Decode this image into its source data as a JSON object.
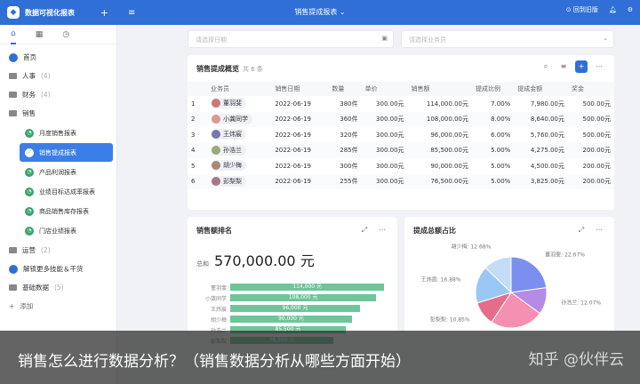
{
  "app": {
    "title": "数据可视化报表",
    "page_title": "销售提成报表",
    "return_label": "回到旧版"
  },
  "sidebar": {
    "items": [
      {
        "label": "首页",
        "count": ""
      },
      {
        "label": "人事",
        "count": "(4)"
      },
      {
        "label": "财务",
        "count": "(4)"
      },
      {
        "label": "销售",
        "count": ""
      },
      {
        "label": "运营",
        "count": "(2)"
      },
      {
        "label": "解锁更多技能＆干货",
        "count": ""
      },
      {
        "label": "基础数据",
        "count": "(5)"
      }
    ],
    "sales_subitems": [
      "月度销售报表",
      "销售提成报表",
      "产品利润报表",
      "业绩目标达成率报表",
      "商品销售库存报表",
      "门店业绩报表"
    ],
    "add_label": "添加"
  },
  "filters": {
    "date_placeholder": "请选择日期",
    "salesperson_placeholder": "请选择业务员"
  },
  "table_card": {
    "title": "销售提成概览",
    "subtitle": "共 6 条",
    "columns": [
      "业务员",
      "销售日期",
      "数量",
      "单价",
      "销售额",
      "提成比例",
      "提成金额",
      "奖金"
    ],
    "rows": [
      {
        "idx": "1",
        "name": "董羽斐",
        "date": "2022-06-19",
        "qty": "380件",
        "price": "300.00元",
        "sales": "114,000.00元",
        "rate": "7.00%",
        "commission": "7,980.00元",
        "bonus": "500.00元"
      },
      {
        "idx": "2",
        "name": "小龚同学",
        "date": "2022-06-19",
        "qty": "360件",
        "price": "300.00元",
        "sales": "108,000.00元",
        "rate": "8.00%",
        "commission": "8,640.00元",
        "bonus": "500.00元"
      },
      {
        "idx": "3",
        "name": "王炜宸",
        "date": "2022-06-19",
        "qty": "320件",
        "price": "300.00元",
        "sales": "96,000.00元",
        "rate": "6.00%",
        "commission": "5,760.00元",
        "bonus": "500.00元"
      },
      {
        "idx": "4",
        "name": "孙浩兰",
        "date": "2022-06-19",
        "qty": "285件",
        "price": "300.00元",
        "sales": "85,500.00元",
        "rate": "5.00%",
        "commission": "4,275.00元",
        "bonus": "200.00元"
      },
      {
        "idx": "5",
        "name": "胡少梅",
        "date": "2022-06-19",
        "qty": "300件",
        "price": "300.00元",
        "sales": "90,000.00元",
        "rate": "5.00%",
        "commission": "4,500.00元",
        "bonus": "200.00元"
      },
      {
        "idx": "6",
        "name": "彭梨梨",
        "date": "2022-06-19",
        "qty": "255件",
        "price": "300.00元",
        "sales": "76,500.00元",
        "rate": "5.00%",
        "commission": "3,825.00元",
        "bonus": "200.00元"
      }
    ]
  },
  "ranking_card": {
    "title": "销售额排名",
    "total_label": "总和",
    "total_value": "570,000.00 元"
  },
  "pie_card": {
    "title": "提成总额占比"
  },
  "chart_data": [
    {
      "type": "bar",
      "categories": [
        "董羽斐",
        "小龚同学",
        "王炜宸",
        "胡少梅",
        "孙浩兰",
        "彭梨梨"
      ],
      "values": [
        114000,
        108000,
        96000,
        90000,
        85500,
        76500
      ],
      "labels": [
        "114,000 元",
        "108,000 元",
        "96,000 元",
        "90,000 元",
        "85,500 元",
        "76,500 元"
      ],
      "bar_color": "#6fc49a"
    },
    {
      "type": "pie",
      "slices": [
        {
          "name": "董羽斐",
          "value": 22.67,
          "label": "董羽斐: 22.67%",
          "color": "#7b8ff0"
        },
        {
          "name": "孙浩兰",
          "value": 12.07,
          "label": "孙浩兰: 12.07%",
          "color": "#b58be6"
        },
        {
          "name": "小龚同学",
          "value": 24.0,
          "label": "小龚同学:",
          "color": "#f48fb1"
        },
        {
          "name": "彭梨梨",
          "value": 10.85,
          "label": "彭梨梨: 10.85%",
          "color": "#e66d8a"
        },
        {
          "name": "王炜宸",
          "value": 16.88,
          "label": "王炜宸: 16.88%",
          "color": "#9bc7f5"
        },
        {
          "name": "胡少梅",
          "value": 12.68,
          "label": "胡少梅: 12.68%",
          "color": "#c5dcf7"
        }
      ]
    }
  ],
  "banner": {
    "text": "销售怎么进行数据分析？（销售数据分析从哪些方面开始）",
    "watermark": "知乎 @伙伴云"
  }
}
